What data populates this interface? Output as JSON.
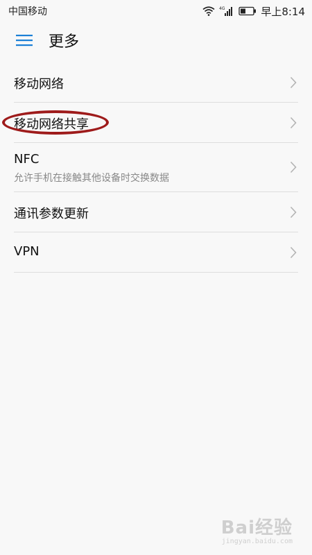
{
  "status_bar": {
    "carrier": "中国移动",
    "network_type": "4G",
    "time": "早上8:14"
  },
  "header": {
    "title": "更多",
    "menu_icon": "hamburger-icon"
  },
  "settings": {
    "items": [
      {
        "title": "移动网络",
        "subtitle": ""
      },
      {
        "title": "移动网络共享",
        "subtitle": ""
      },
      {
        "title": "NFC",
        "subtitle": "允许手机在接触其他设备时交换数据"
      },
      {
        "title": "通讯参数更新",
        "subtitle": ""
      },
      {
        "title": "VPN",
        "subtitle": ""
      }
    ]
  },
  "annotation": {
    "highlight_color": "#9e1b1b"
  },
  "watermark": {
    "logo": "Bai经验",
    "url": "jingyan.baidu.com"
  },
  "colors": {
    "accent": "#1a7fd6",
    "background": "#f8f8f8",
    "divider": "#dddddd"
  }
}
